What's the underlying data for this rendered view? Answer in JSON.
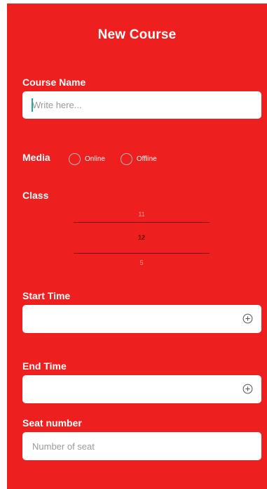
{
  "header": {
    "title": "New Course"
  },
  "course_name": {
    "label": "Course Name",
    "placeholder": "Write here..."
  },
  "media": {
    "label": "Media",
    "options": [
      {
        "label": "Online"
      },
      {
        "label": "Offline"
      }
    ]
  },
  "class": {
    "label": "Class",
    "picker": {
      "above": "11",
      "selected": "12",
      "below": "5"
    }
  },
  "start_time": {
    "label": "Start Time"
  },
  "end_time": {
    "label": "End Time"
  },
  "seat_number": {
    "label": "Seat number",
    "placeholder": "Number of seat"
  },
  "colors": {
    "background": "#ed1f1f",
    "field": "#ffffff",
    "picker_line": "#7a0f0f"
  },
  "icons": {
    "add_time": "plus-circle-icon"
  }
}
